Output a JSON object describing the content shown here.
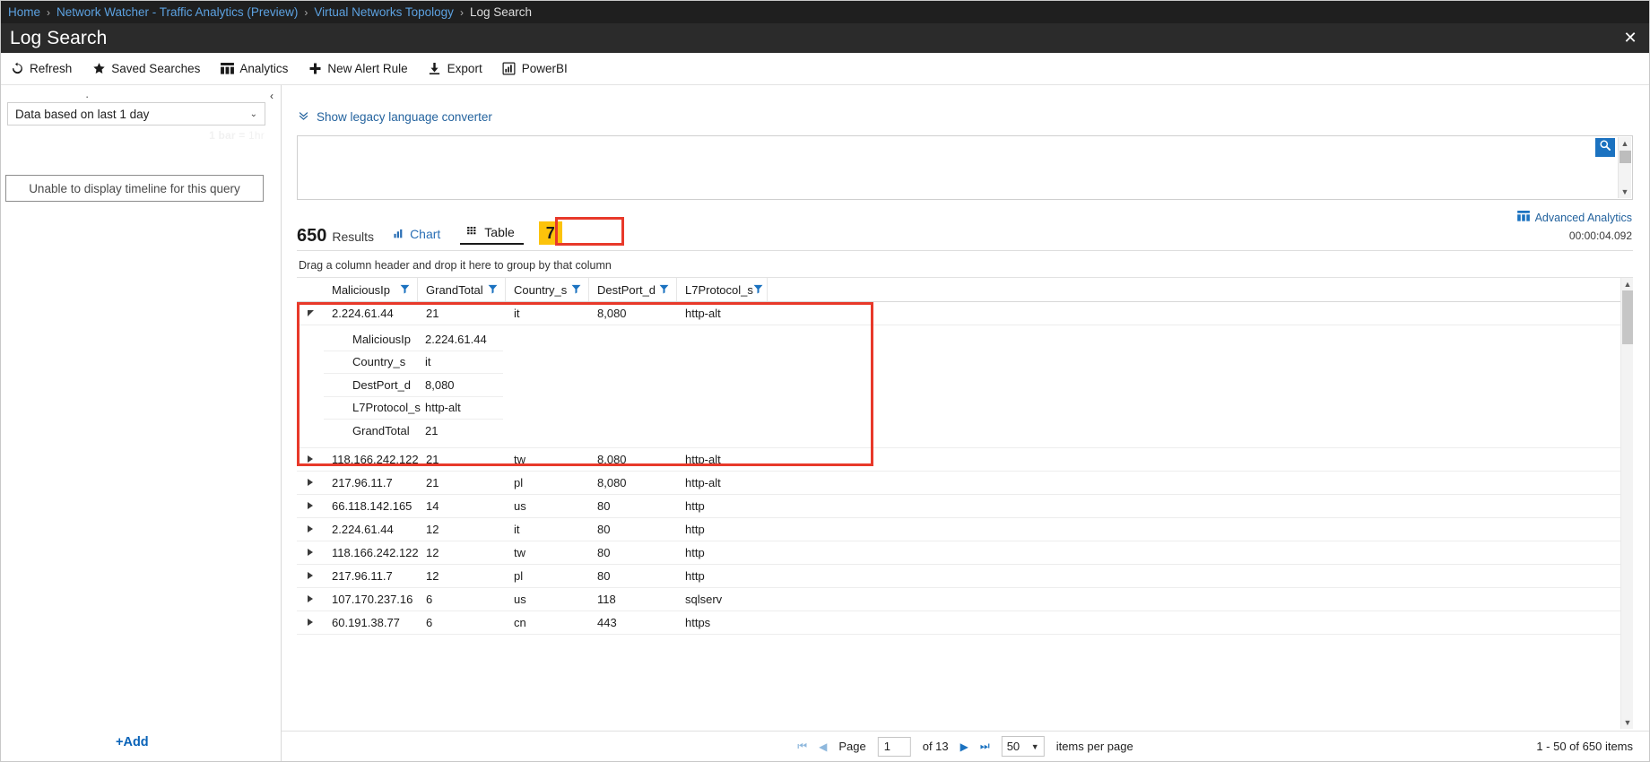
{
  "breadcrumb": {
    "items": [
      "Home",
      "Network Watcher - Traffic Analytics (Preview)",
      "Virtual Networks Topology",
      "Log Search"
    ],
    "separator": "›"
  },
  "header": {
    "title": "Log Search",
    "close_label": "✕"
  },
  "toolbar": {
    "items": [
      {
        "label": "Refresh",
        "icon": "refresh-icon"
      },
      {
        "label": "Saved Searches",
        "icon": "star-icon"
      },
      {
        "label": "Analytics",
        "icon": "analytics-icon"
      },
      {
        "label": "New Alert Rule",
        "icon": "plus-icon"
      },
      {
        "label": "Export",
        "icon": "export-icon"
      },
      {
        "label": "PowerBI",
        "icon": "powerbi-icon"
      }
    ]
  },
  "left_panel": {
    "collapse_icon": "‹",
    "dot": "·",
    "time_range": {
      "value": "Data based on last 1 day",
      "chevron": "⌄"
    },
    "bar_note_bold": "1 bar =",
    "bar_note_rest": " 1hr",
    "timeline_message": "Unable to display timeline for this query",
    "add_label": "+Add"
  },
  "query": {
    "legacy_link": "Show legacy language converter",
    "legacy_icon": "chevron-double-down-icon",
    "value": "",
    "placeholder": "",
    "search_icon": "search-icon"
  },
  "results": {
    "count": "650",
    "label": "Results",
    "tabs": [
      {
        "label": "Chart",
        "icon": "chart-icon",
        "active": false
      },
      {
        "label": "Table",
        "icon": "table-icon",
        "active": true
      }
    ],
    "badge": "7",
    "advanced_analytics": "Advanced Analytics",
    "elapsed": "00:00:04.092",
    "group_hint": "Drag a column header and drop it here to group by that column"
  },
  "grid": {
    "columns": [
      "MaliciousIp",
      "GrandTotal",
      "Country_s",
      "DestPort_d",
      "L7Protocol_s"
    ],
    "filter_icon": "filter-icon",
    "expanded_row": {
      "expander": "triangle-down-icon",
      "cells": [
        "2.224.61.44",
        "21",
        "it",
        "8,080",
        "http-alt"
      ],
      "detail": [
        {
          "key": "MaliciousIp",
          "value": "2.224.61.44"
        },
        {
          "key": "Country_s",
          "value": "it"
        },
        {
          "key": "DestPort_d",
          "value": "8,080"
        },
        {
          "key": "L7Protocol_s",
          "value": "http-alt"
        },
        {
          "key": "GrandTotal",
          "value": "21"
        }
      ]
    },
    "rows": [
      [
        "118.166.242.122",
        "21",
        "tw",
        "8,080",
        "http-alt"
      ],
      [
        "217.96.11.7",
        "21",
        "pl",
        "8,080",
        "http-alt"
      ],
      [
        "66.118.142.165",
        "14",
        "us",
        "80",
        "http"
      ],
      [
        "2.224.61.44",
        "12",
        "it",
        "80",
        "http"
      ],
      [
        "118.166.242.122",
        "12",
        "tw",
        "80",
        "http"
      ],
      [
        "217.96.11.7",
        "12",
        "pl",
        "80",
        "http"
      ],
      [
        "107.170.237.16",
        "6",
        "us",
        "118",
        "sqlserv"
      ],
      [
        "60.191.38.77",
        "6",
        "cn",
        "443",
        "https"
      ]
    ]
  },
  "pager": {
    "first_icon": "⏮",
    "prev_icon": "◀",
    "page_label": "Page",
    "page_value": "1",
    "of_label": "of 13",
    "next_icon": "▶",
    "last_icon": "⏭",
    "page_size": "50",
    "page_size_label": "items per page",
    "range_label": "1 - 50 of 650 items"
  },
  "colors": {
    "accent_blue": "#1b72c0",
    "link_blue": "#24639e",
    "highlight_red": "#e8392a",
    "badge_yellow": "#fcc30b",
    "header_dark": "#2b2b2b"
  }
}
